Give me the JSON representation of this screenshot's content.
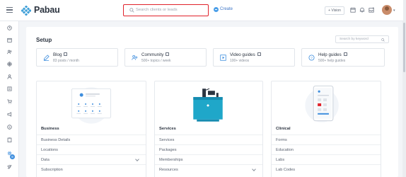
{
  "app": {
    "name": "Pabau"
  },
  "topbar": {
    "search_placeholder": "Search clients or leads",
    "create_label": "Create",
    "vision_label": "+ Vision",
    "icons": [
      "calendar-icon",
      "bell-icon",
      "inbox-icon"
    ]
  },
  "sidebar": {
    "items": [
      "clock-icon",
      "calendar-icon",
      "users-icon",
      "target-icon",
      "person-icon",
      "report-icon",
      "cart-icon",
      "megaphone-icon",
      "dollar-icon",
      "clipboard-icon",
      "gear-icon",
      "rocket-icon"
    ],
    "badge_count": "8"
  },
  "setup": {
    "title": "Setup",
    "search_placeholder": "Search by keyword",
    "cards": [
      {
        "title": "Blog",
        "subtitle": "83 posts / month"
      },
      {
        "title": "Community",
        "subtitle": "500+ topics / week"
      },
      {
        "title": "Video guides",
        "subtitle": "100+ videos"
      },
      {
        "title": "Help guides",
        "subtitle": "500+ help guides"
      }
    ],
    "sections": [
      {
        "heading": "Business",
        "items": [
          "Business Details",
          "Locations",
          "Data",
          "Subscription"
        ]
      },
      {
        "heading": "Services",
        "items": [
          "Services",
          "Packages",
          "Memberships",
          "Resources"
        ]
      },
      {
        "heading": "Clinical",
        "items": [
          "Forms",
          "Education",
          "Labs",
          "Lab Codes"
        ]
      }
    ]
  },
  "colors": {
    "accent": "#3e8ede",
    "highlight": "#e0222b",
    "teal": "#1fa7c9"
  }
}
